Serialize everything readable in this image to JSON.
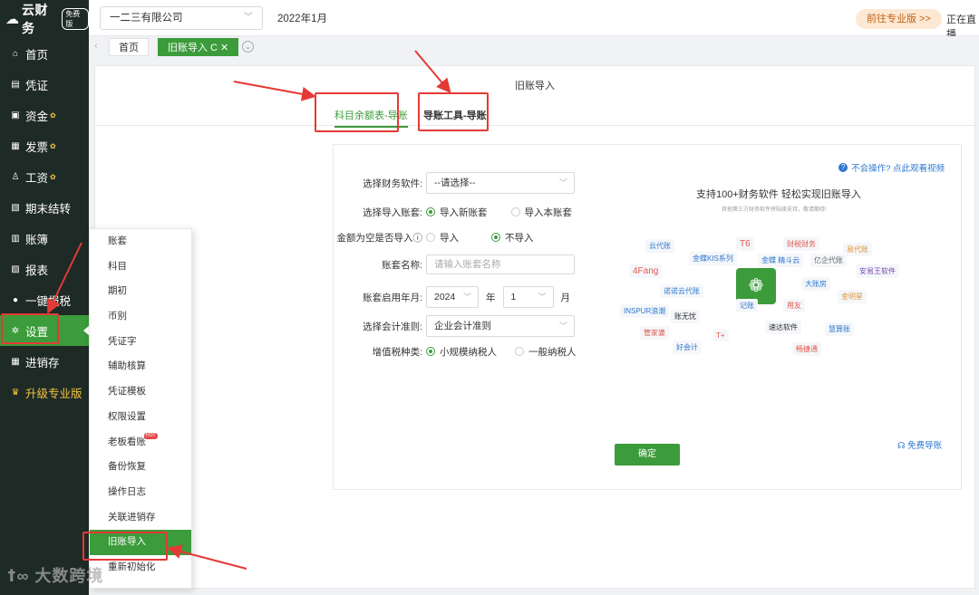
{
  "app": {
    "logo_text": "云财务",
    "logo_badge": "免费版"
  },
  "sidebar": {
    "items": [
      {
        "label": "首页",
        "icon": "home-icon",
        "glyph": "⌂"
      },
      {
        "label": "凭证",
        "icon": "voucher-icon",
        "glyph": "▤"
      },
      {
        "label": "资金",
        "icon": "fund-icon",
        "glyph": "▣"
      },
      {
        "label": "发票",
        "icon": "invoice-icon",
        "glyph": "▦"
      },
      {
        "label": "工资",
        "icon": "salary-icon",
        "glyph": "♙"
      },
      {
        "label": "期末结转",
        "icon": "period-end-icon",
        "glyph": "▧"
      },
      {
        "label": "账簿",
        "icon": "ledger-icon",
        "glyph": "▥"
      },
      {
        "label": "报表",
        "icon": "report-icon",
        "glyph": "▨"
      },
      {
        "label": "一键报税",
        "icon": "tax-icon",
        "glyph": "●"
      },
      {
        "label": "设置",
        "icon": "settings-icon",
        "glyph": "✲"
      },
      {
        "label": "进销存",
        "icon": "inventory-icon",
        "glyph": "▦"
      },
      {
        "label": "升级专业版",
        "icon": "crown-icon",
        "glyph": "♛"
      }
    ],
    "active_index": 9,
    "badge_glyph": "✿"
  },
  "header": {
    "company": "一二三有限公司",
    "period": "2022年1月",
    "pro_button": "前往专业版 >>",
    "live_text": "正在直播"
  },
  "tabs": {
    "home": "首页",
    "active": "旧账导入 C ✕"
  },
  "main": {
    "title": "旧账导入",
    "subtabs": [
      "科目余额表-导账",
      "导账工具-导账"
    ]
  },
  "form": {
    "software_label": "选择财务软件:",
    "software_value": "--请选择--",
    "account_set_label": "选择导入账套:",
    "account_set_options": [
      "导入新账套",
      "导入本账套"
    ],
    "zero_label": "金额为空是否导入",
    "zero_options": [
      "导入",
      "不导入"
    ],
    "name_label": "账套名称:",
    "name_placeholder": "请输入账套名称",
    "start_label": "账套启用年月:",
    "year_value": "2024",
    "year_unit": "年",
    "month_value": "1",
    "month_unit": "月",
    "standard_label": "选择会计准则:",
    "standard_value": "企业会计准则",
    "tax_label": "增值税种类:",
    "tax_options": [
      "小规模纳税人",
      "一般纳税人"
    ],
    "confirm": "确定"
  },
  "promo": {
    "help_link": "不会操作? 点此观看视频",
    "title": "支持100+财务软件   轻松实现旧账导入",
    "subtitle": "其他第三方财务软件将陆续支持，敬请期待!",
    "free_link": "免费导账",
    "brands": [
      {
        "label": "T6",
        "color": "#e05a4e"
      },
      {
        "label": "4Fang",
        "color": "#e05a4e"
      },
      {
        "label": "金蝶KIS系列",
        "color": "#2d78d0"
      },
      {
        "label": "金蝶 精斗云",
        "color": "#2d78d0"
      },
      {
        "label": "亿企代账",
        "color": "#666"
      },
      {
        "label": "安易王软件",
        "color": "#7b4ab8"
      },
      {
        "label": "诺诺云代账",
        "color": "#2d78d0"
      },
      {
        "label": "大账房",
        "color": "#2d78d0"
      },
      {
        "label": "金明星",
        "color": "#e0943a"
      },
      {
        "label": "INSPUR浪潮",
        "color": "#2d78d0"
      },
      {
        "label": "账无忧",
        "color": "#333"
      },
      {
        "label": "用友",
        "color": "#e05a4e"
      },
      {
        "label": "管家婆",
        "color": "#e05a4e"
      },
      {
        "label": "T+",
        "color": "#e05a4e"
      },
      {
        "label": "速达软件",
        "color": "#333"
      },
      {
        "label": "好会计",
        "color": "#2d78d0"
      },
      {
        "label": "畅捷通",
        "color": "#e05a4e"
      },
      {
        "label": "记账",
        "color": "#2d78d0"
      },
      {
        "label": "云代账",
        "color": "#2d78d0"
      },
      {
        "label": "财税财务",
        "color": "#e05a4e"
      },
      {
        "label": "易代账",
        "color": "#e0943a"
      },
      {
        "label": "慧算账",
        "color": "#2d78d0"
      }
    ]
  },
  "settings_menu": {
    "items": [
      "账套",
      "科目",
      "期初",
      "币别",
      "凭证字",
      "辅助核算",
      "凭证模板",
      "权限设置",
      "老板看账",
      "备份恢复",
      "操作日志",
      "关联进销存",
      "旧账导入",
      "重新初始化"
    ],
    "active_index": 12,
    "hot_badge": "HOT"
  },
  "watermark": "大数跨境",
  "colors": {
    "brand_green": "#3c9b3a",
    "sidebar_bg": "#1e2a25",
    "annotation_red": "#e53935",
    "link_blue": "#2d78d0"
  }
}
